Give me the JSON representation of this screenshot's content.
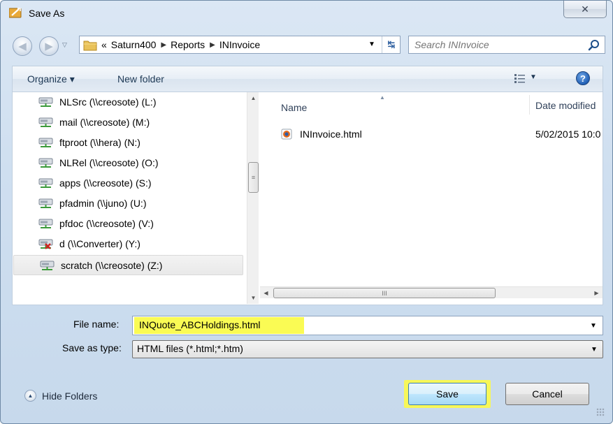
{
  "window": {
    "title": "Save As",
    "close_glyph": "✕"
  },
  "nav": {
    "breadcrumb": [
      "«",
      "Saturn400",
      "Reports",
      "INInvoice"
    ],
    "search_placeholder": "Search INInvoice"
  },
  "toolbar": {
    "organize": "Organize ▾",
    "new_folder": "New folder",
    "help": "?"
  },
  "tree": {
    "items": [
      {
        "label": "NLSrc (\\\\creosote) (L:)",
        "icon": "network-drive-icon",
        "selected": false
      },
      {
        "label": "mail (\\\\creosote) (M:)",
        "icon": "network-drive-icon",
        "selected": false
      },
      {
        "label": "ftproot (\\\\hera) (N:)",
        "icon": "network-drive-icon",
        "selected": false
      },
      {
        "label": "NLRel (\\\\creosote) (O:)",
        "icon": "network-drive-icon",
        "selected": false
      },
      {
        "label": "apps (\\\\creosote) (S:)",
        "icon": "network-drive-icon",
        "selected": false
      },
      {
        "label": "pfadmin (\\\\juno) (U:)",
        "icon": "network-drive-icon",
        "selected": false
      },
      {
        "label": "pfdoc (\\\\creosote) (V:)",
        "icon": "network-drive-icon",
        "selected": false
      },
      {
        "label": "d (\\\\Converter) (Y:)",
        "icon": "disconnected-drive-icon",
        "selected": false
      },
      {
        "label": "scratch (\\\\creosote) (Z:)",
        "icon": "network-drive-icon",
        "selected": true
      }
    ]
  },
  "files": {
    "columns": {
      "name": "Name",
      "date": "Date modified"
    },
    "rows": [
      {
        "name": "INInvoice.html",
        "date": "5/02/2015 10:0"
      }
    ]
  },
  "form": {
    "file_name_label": "File name:",
    "file_name_value": "INQuote_ABCHoldings.html",
    "save_type_label": "Save as type:",
    "save_type_value": "HTML files (*.html;*.htm)"
  },
  "footer": {
    "hide_folders": "Hide Folders",
    "save": "Save",
    "cancel": "Cancel"
  },
  "colors": {
    "highlight": "#fafb54",
    "window_bg": "#cfdff0",
    "accent": "#2160b6"
  }
}
